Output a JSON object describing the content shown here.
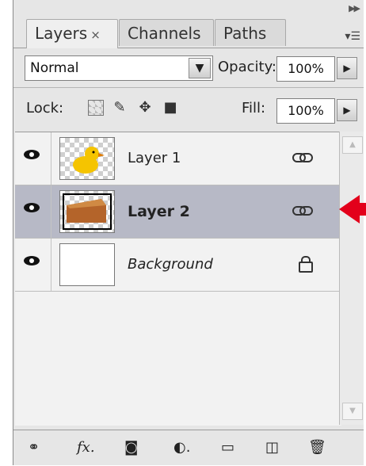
{
  "tabs": [
    {
      "label": "Layers",
      "close": "×"
    },
    {
      "label": "Channels"
    },
    {
      "label": "Paths"
    }
  ],
  "blend_mode": "Normal",
  "opacity": {
    "label": "Opacity:",
    "value": "100%"
  },
  "lock": {
    "label": "Lock:"
  },
  "fill": {
    "label": "Fill:",
    "value": "100%"
  },
  "layers": [
    {
      "name": "Layer 1",
      "thumb": "duck"
    },
    {
      "name": "Layer 2",
      "thumb": "brown",
      "selected": true
    },
    {
      "name": "Background",
      "thumb": "white"
    }
  ],
  "colors": {
    "selection": "#b7b9c6",
    "arrow": "#e3001b"
  }
}
